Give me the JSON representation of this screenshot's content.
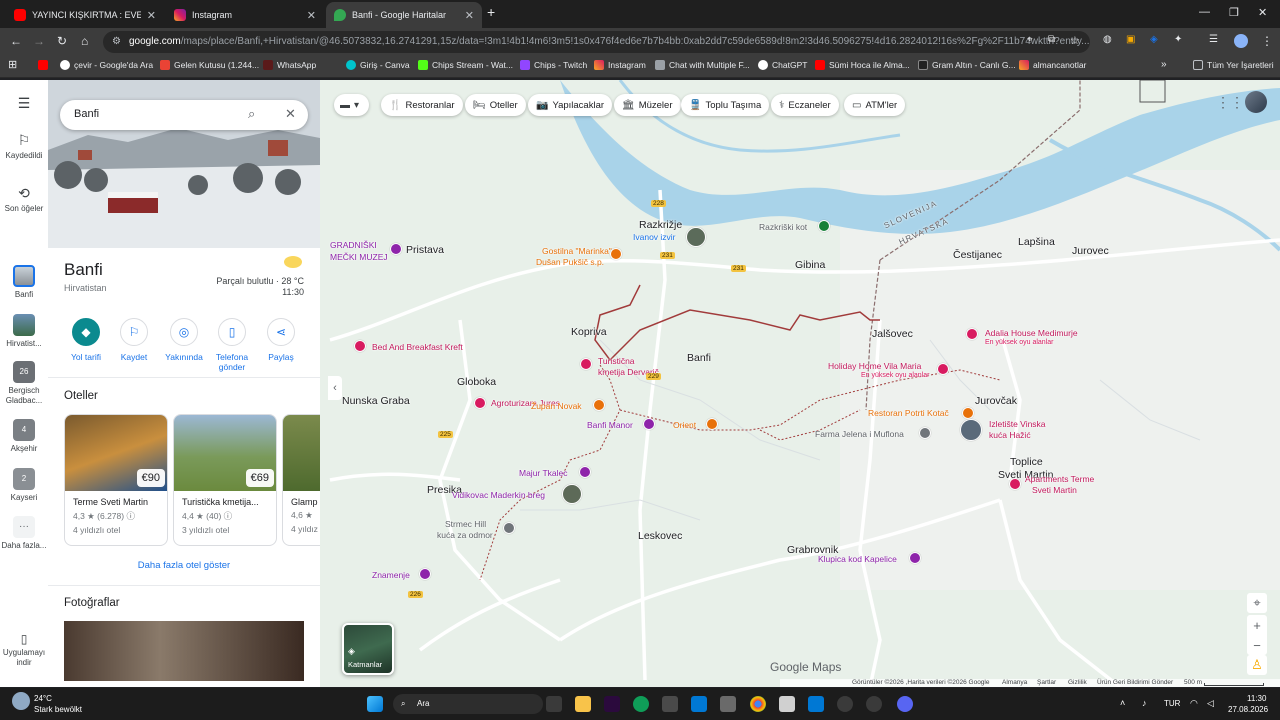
{
  "tabs": [
    {
      "title": "YAYINCI KIŞKIRTMA : EVE DÖNÜ",
      "state": "inactive"
    },
    {
      "title": "Instagram",
      "state": "inactive"
    },
    {
      "title": "Banfi - Google Haritalar",
      "state": "active"
    }
  ],
  "address": {
    "host": "google.com",
    "path": "/maps/place/Banfi,+Hirvatistan/@46.5073832,16.2741291,15z/data=!3m1!4b1!4m6!3m5!1s0x476f4ed6e7b7b4bb:0xab2dd7c59de6589d!8m2!3d46.5096275!4d16.2824012!16s%2Fg%2F11b74wkttn?entry..."
  },
  "bookmarks": [
    "çevir - Google'da Ara",
    "Gelen Kutusu (1.244...",
    "WhatsApp",
    "Giriş - Canva",
    "Chips Stream - Wat...",
    "Chips - Twitch",
    "Instagram",
    "Chat with Multiple F...",
    "ChatGPT",
    "Sümi Hoca ile Alma...",
    "Gram Altın - Canlı G...",
    "almancanotlar"
  ],
  "bookmarks_all": "Tüm Yer İşaretleri",
  "rail": {
    "saved": "Kaydedildi",
    "recent": "Son öğeler",
    "banfi": "Banfi",
    "hirvatistan": "Hirvatist...",
    "bergisch": "Bergisch Gladbac...",
    "aksehir": "Akşehir",
    "kayseri": "Kayseri",
    "more": "Daha fazla...",
    "apps": "Uygulamayı indir",
    "badge_bergisch": "26",
    "badge_aksehir": "4",
    "badge_kayseri": "2"
  },
  "search": {
    "value": "Banfi"
  },
  "place": {
    "name": "Banfi",
    "country": "Hirvatistan",
    "weather": "Parçalı bulutlu · 28 °C",
    "time": "11:30"
  },
  "actions": [
    "Yol tarifi",
    "Kaydet",
    "Yakınında",
    "Telefona gönder",
    "Paylaş"
  ],
  "hotels_title": "Oteller",
  "hotels": [
    {
      "name": "Terme Sveti Martin",
      "rating": "4,3 ★ (6.278)",
      "class": "4 yıldızlı otel",
      "price": "€90"
    },
    {
      "name": "Turistička kmetija...",
      "rating": "4,4 ★ (40)",
      "class": "3 yıldızlı otel",
      "price": "€69"
    },
    {
      "name": "Glamp",
      "rating": "4,6 ★",
      "class": "4 yıldız",
      "price": ""
    }
  ],
  "more_hotels": "Daha fazla otel göster",
  "photos_title": "Fotoğraflar",
  "chips": [
    "Restoranlar",
    "Oteller",
    "Yapılacaklar",
    "Müzeler",
    "Toplu Taşıma",
    "Eczaneler",
    "ATM'ler"
  ],
  "map_labels": {
    "razkrizje": "Razkrižje",
    "ivanov": "Ivanov izvir",
    "razkriski": "Razkriški kot",
    "gibina": "Gibina",
    "slovenija": "SLOVENIJA",
    "hrvatska": "HRVATSKA",
    "cestijanec": "Čestijanec",
    "lapsina": "Lapšina",
    "jurovec": "Jurovec",
    "pristava": "Pristava",
    "gradniski": "GRADNIŠKI",
    "mecki": "MEČKI MUZEJ",
    "gostilna": "Gostilna \"Marinka\"",
    "dusan": "Dušan Pukšič s.p.",
    "kopriva": "Kopriva",
    "banfi": "Banfi",
    "jalsovec": "Jalšovec",
    "bnb": "Bed And Breakfast Kreft",
    "turisticna": "Turistična",
    "kmetija": "kmetija Dervarič",
    "adalia": "Adalia House Medimurje",
    "adalia_sub": "En yüksek oyu alanlar",
    "holiday": "Holiday Home Vila Maria",
    "holiday_sub": "En yüksek oyu alanlar",
    "globoka": "Globoka",
    "nunska": "Nunska Graba",
    "agroturizam": "Agroturizam Jures",
    "zupan": "Župan Novak",
    "restoran": "Restoran Potrti Kotač",
    "jurovcak": "Jurovčak",
    "banfi_manor": "Banfi Manor",
    "orient": "Orient",
    "farma": "Farma Jelena i Muflona",
    "izletiste": "Izletište Vinska",
    "kuca_hazic": "kuća Hažić",
    "majur": "Majur Tkalec",
    "presika": "Presika",
    "vidikovac": "Vidikovac Maderkin breg",
    "toplice": "Toplice",
    "sveti_martin": "Sveti Martin",
    "apartments": "Apartments Terme",
    "apartments2": "Sveti Martin",
    "strmec": "Strmec Hill",
    "kuca_odmor": "kuća za odmor",
    "leskovec": "Leskovec",
    "grabrovnik": "Grabrovnik",
    "klupica": "Klupica kod Kapelice",
    "znamenje": "Znamenje"
  },
  "road_numbers": [
    "228",
    "231",
    "231",
    "229",
    "225",
    "226"
  ],
  "layers_label": "Katmanlar",
  "brand": "Google Maps",
  "footer": [
    "Görüntüler ©2026 ,Harita verileri ©2026 Google",
    "Almanya",
    "Şartlar",
    "Gizlilik",
    "Ürün Geri Bildirimi Gönder",
    "500 m"
  ],
  "taskbar": {
    "temp": "24°C",
    "weather": "Stark bewölkt",
    "search": "Ara",
    "lang": "TUR",
    "time": "11:30",
    "date": "27.08.2026"
  },
  "colors": {
    "map_bg": "#e9f1ea",
    "water": "#a9d3e9",
    "accent": "#1a73e8",
    "route": "#a13b3b",
    "teal": "#0b8a8f"
  }
}
